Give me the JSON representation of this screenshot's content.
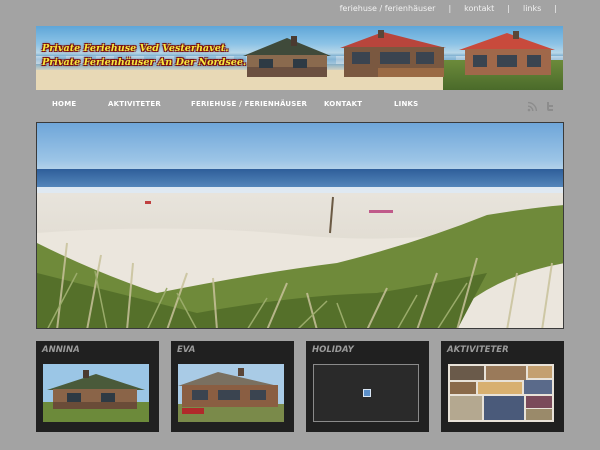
{
  "top_links": [
    "feriehuse / ferienhäuser",
    "kontakt",
    "links"
  ],
  "banner": {
    "line1": "Private Feriehuse Ved Vesterhavet.",
    "line2": "Private Ferienhäuser An Der Nordsee."
  },
  "nav": {
    "items": [
      "HOME",
      "AKTIVITETER",
      "FERIEHUSE / FERIENHÄUSER",
      "KONTAKT",
      "LINKS"
    ],
    "icons": [
      "rss-icon",
      "twitter-icon"
    ]
  },
  "breadcrumb": " ",
  "hero_alt": "beach",
  "boxes": [
    {
      "title": "ANNINA"
    },
    {
      "title": "EVA"
    },
    {
      "title": "HOLIDAY"
    },
    {
      "title": "AKTIVITETER"
    }
  ]
}
